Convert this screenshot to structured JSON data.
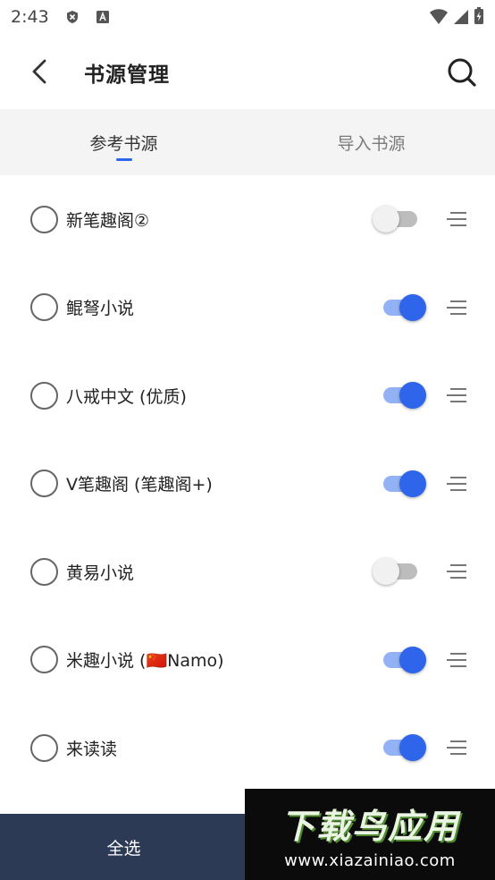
{
  "status_bar": {
    "time": "2:43"
  },
  "app_bar": {
    "title": "书源管理"
  },
  "tabs": [
    {
      "label": "参考书源",
      "active": true
    },
    {
      "label": "导入书源",
      "active": false
    }
  ],
  "sources": [
    {
      "name": "新笔趣阁②",
      "enabled": false
    },
    {
      "name": "鲲弩小说",
      "enabled": true
    },
    {
      "name": "八戒中文 (优质)",
      "enabled": true
    },
    {
      "name": "V笔趣阁 (笔趣阁+)",
      "enabled": true
    },
    {
      "name": "黄易小说",
      "enabled": false
    },
    {
      "name": "米趣小说 (🇨🇳Namo)",
      "enabled": true
    },
    {
      "name": "来读读",
      "enabled": true
    }
  ],
  "bottom_bar": {
    "select_all": "全选"
  },
  "watermark": {
    "title": "下载鸟应用",
    "url": "www.xiazainiao.com"
  },
  "colors": {
    "accent": "#2f65ea",
    "accent_light": "#93b2f5",
    "bottom_bar": "#2d3a55",
    "tabs_bg": "#f4f4f4"
  }
}
